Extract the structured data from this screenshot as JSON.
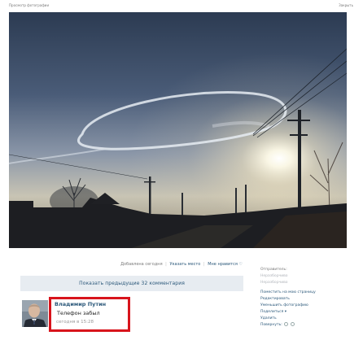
{
  "header": {
    "title": "Просмотр фотографии",
    "close_label": "Закрыть"
  },
  "photo_meta": {
    "added": "Добавлена сегодня",
    "tag_location": "Указать место",
    "likes": "Мне нравится"
  },
  "comments": {
    "show_previous": "Показать предыдущие 32 комментария",
    "items": [
      {
        "author": "Владимир Путин",
        "text": "Телефон забыл",
        "date": "сегодня в 15:28"
      }
    ]
  },
  "sidebar": {
    "sender_label": "Отправитель:",
    "sender_name": "Неразборчиво",
    "sender_sub": "Неразборчиво",
    "actions": {
      "put_on_page": "Поместить на мою страницу",
      "edit": "Редактировать",
      "reduce_photo": "Уменьшить фотографию",
      "share": "Поделиться",
      "delete": "Удалить",
      "rotate": "Повернуть:"
    }
  },
  "colors": {
    "link": "#2b587a",
    "highlight": "#d8141c",
    "button_bg": "#e7ecf1"
  }
}
